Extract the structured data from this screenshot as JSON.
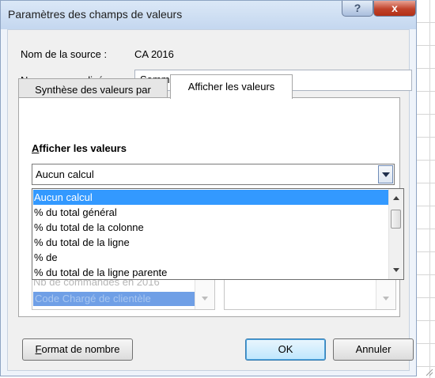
{
  "window": {
    "title": "Paramètres des champs de valeurs",
    "help_label": "?",
    "close_label": "x"
  },
  "source": {
    "label": "Nom de la source :",
    "value": "CA 2016"
  },
  "custom_name": {
    "label_underlined": "N",
    "label_rest": "om personnalisé :",
    "value": "Somme de CA 2016"
  },
  "tabs": [
    {
      "label": "Synthèse des valeurs par",
      "active": false
    },
    {
      "label": "Afficher les valeurs",
      "active": true
    }
  ],
  "panel": {
    "section_underlined": "A",
    "section_rest": "fficher les valeurs",
    "combo_value": "Aucun calcul",
    "dropdown_options": [
      "Aucun calcul",
      "% du total général",
      "% du total de la colonne",
      "% du total de la ligne",
      "% de",
      "% du total de la ligne parente"
    ],
    "selected_option": "Aucun calcul",
    "base_field_items": [
      "Nb de commandes en 2016",
      "Code Chargé de clientèle"
    ]
  },
  "buttons": {
    "format_underlined": "F",
    "format_rest": "ormat de nombre",
    "ok": "OK",
    "cancel": "Annuler"
  },
  "colors": {
    "selection": "#3399ff",
    "title_bg": "#c4d7ef",
    "close_button": "#c0422a"
  }
}
